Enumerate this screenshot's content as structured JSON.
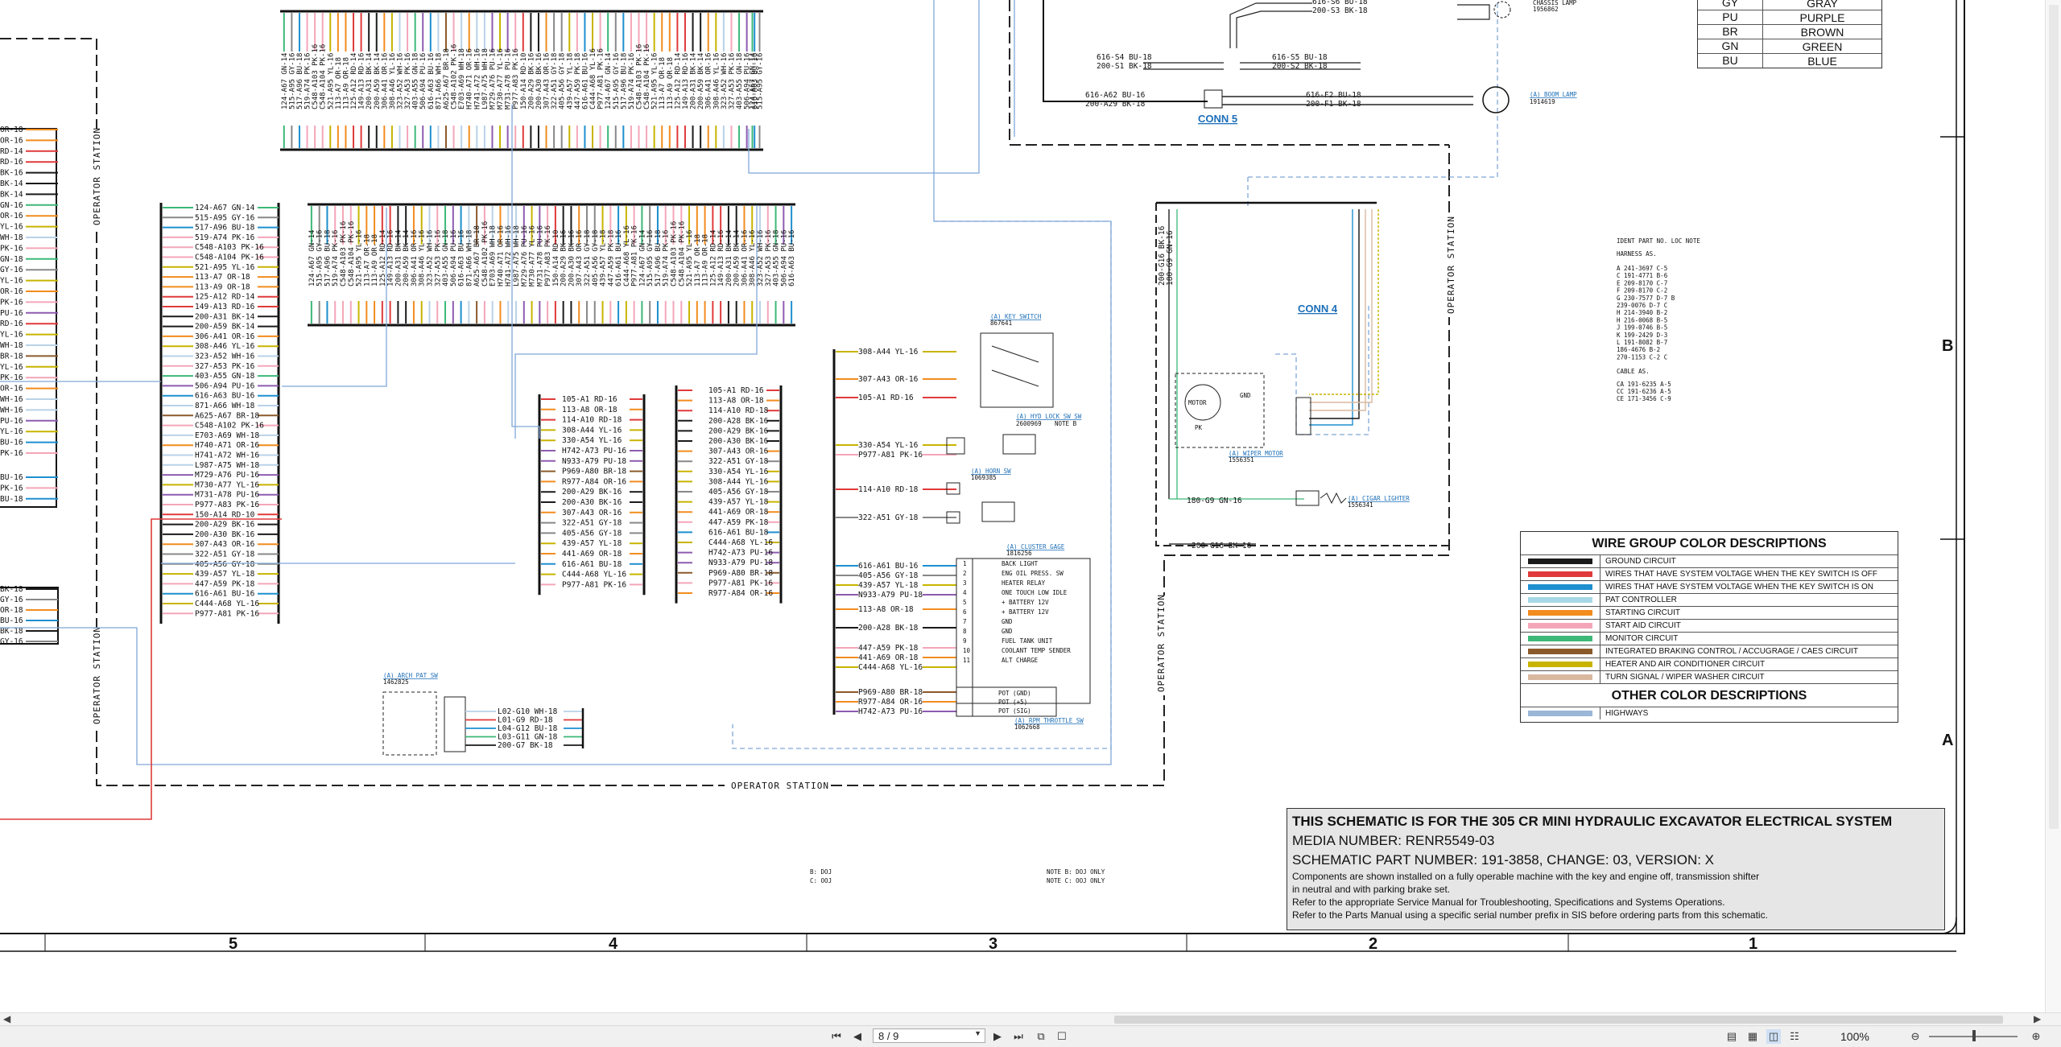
{
  "zones": {
    "col5": "5",
    "col4": "4",
    "col3": "3",
    "col2": "2",
    "col1": "1",
    "rowB": "B",
    "rowA": "A"
  },
  "stations": {
    "operator_station": "OPERATOR STATION"
  },
  "connectors": {
    "conn5": "CONN 5",
    "conn4": "CONN 4"
  },
  "colortable": [
    {
      "code": "GY",
      "name": "GRAY"
    },
    {
      "code": "PU",
      "name": "PURPLE"
    },
    {
      "code": "BR",
      "name": "BROWN"
    },
    {
      "code": "GN",
      "name": "GREEN"
    },
    {
      "code": "BU",
      "name": "BLUE"
    }
  ],
  "legend": {
    "title": "WIRE GROUP COLOR DESCRIPTIONS",
    "rows": [
      {
        "color": "#1a1a1a",
        "text": "GROUND CIRCUIT"
      },
      {
        "color": "#e03a3a",
        "text": "WIRES THAT HAVE SYSTEM VOLTAGE WHEN THE KEY SWITCH IS OFF"
      },
      {
        "color": "#1e8fd0",
        "text": "WIRES THAT HAVE SYSTEM VOLTAGE WHEN THE KEY SWITCH IS ON"
      },
      {
        "color": "#a6d8e6",
        "text": "PAT CONTROLLER"
      },
      {
        "color": "#f28c1e",
        "text": "STARTING CIRCUIT"
      },
      {
        "color": "#f4a6b8",
        "text": "START AID CIRCUIT"
      },
      {
        "color": "#3cb878",
        "text": "MONITOR CIRCUIT"
      },
      {
        "color": "#8b5a2b",
        "text": "INTEGRATED BRAKING CONTROL / ACCUGRAGE / CAES CIRCUIT"
      },
      {
        "color": "#c8b400",
        "text": "HEATER AND AIR CONDITIONER CIRCUIT"
      },
      {
        "color": "#d9b8a0",
        "text": "TURN SIGNAL / WIPER WASHER CIRCUIT"
      }
    ],
    "other_title": "OTHER COLOR DESCRIPTIONS",
    "other_rows": [
      {
        "color": "#9bb6d6",
        "text": "HIGHWAYS"
      }
    ]
  },
  "titleblock": {
    "line1": "THIS SCHEMATIC IS FOR THE 305 CR MINI HYDRAULIC EXCAVATOR ELECTRICAL SYSTEM",
    "line2": "MEDIA NUMBER: RENR5549-03",
    "line3": "SCHEMATIC PART NUMBER: 191-3858, CHANGE: 03, VERSION: X",
    "line4": "Components are shown installed on a fully operable machine with the key and engine off, transmission shifter",
    "line5": "in neutral and with parking brake set.",
    "line6": "Refer to the appropriate Service Manual for Troubleshooting, Specifications and Systems Operations.",
    "line7": "Refer to the Parts Manual using a specific serial number prefix in SIS before ordering parts from this schematic."
  },
  "wires": {
    "left_block": [
      "124-A67 GN-14",
      "515-A95 GY-16",
      "517-A96 BU-18",
      "519-A74 PK-16",
      "C548-A103 PK-16",
      "C548-A104 PK-16",
      "521-A95 YL-16",
      "113-A7 OR-18",
      "113-A9 OR-18",
      "125-A12 RD-14",
      "149-A13 RD-16",
      "200-A31 BK-14",
      "200-A59 BK-14",
      "306-A41 OR-16",
      "308-A46 YL-16",
      "323-A52 WH-16",
      "327-A53 PK-16",
      "403-A55 GN-18",
      "506-A94 PU-16",
      "616-A63 BU-16",
      "871-A66 WH-18",
      "A625-A67 BR-18",
      "C548-A102 PK-16",
      "E703-A69 WH-18",
      "H740-A71 OR-16",
      "H741-A72 WH-16",
      "L987-A75 WH-18",
      "M729-A76 PU-16",
      "M730-A77 YL-16",
      "M731-A78 PU-16",
      "P977-A83 PK-16",
      "150-A14 RD-10",
      "200-A29 BK-16",
      "200-A30 BK-16",
      "307-A43 OR-16",
      "322-A51 GY-18",
      "405-A56 GY-18",
      "439-A57 YL-18",
      "447-A59 PK-18",
      "616-A61 BU-16",
      "C444-A68 YL-16",
      "P977-A81 PK-16"
    ],
    "mid_block_a": [
      "105-A1 RD-16",
      "113-A8 OR-18",
      "114-A10 RD-18",
      "308-A44 YL-16",
      "330-A54 YL-16",
      "H742-A73 PU-16",
      "N933-A79 PU-18",
      "P969-A80 BR-18",
      "R977-A84 OR-16",
      "200-A29 BK-16",
      "200-A30 BK-16",
      "307-A43 OR-16",
      "322-A51 GY-18",
      "405-A56 GY-18",
      "439-A57 YL-18",
      "441-A69 OR-18",
      "616-A61 BU-18",
      "C444-A68 YL-16",
      "P977-A81 PK-16"
    ],
    "mid_block_b": [
      "105-A1 RD-16",
      "113-A8 OR-18",
      "114-A10 RD-18",
      "200-A28 BK-16",
      "200-A29 BK-16",
      "200-A30 BK-16",
      "307-A43 OR-16",
      "322-A51 GY-18",
      "330-A54 YL-16",
      "308-A44 YL-16",
      "405-A56 GY-18",
      "439-A57 YL-18",
      "441-A69 OR-18",
      "447-A59 PK-18",
      "616-A61 BU-18",
      "C444-A68 YL-16",
      "H742-A73 PU-16",
      "N933-A79 PU-18",
      "P969-A80 BR-18",
      "P977-A81 PK-16",
      "R977-A84 OR-16"
    ],
    "right_block": [
      "308-A44 YL-16",
      "307-A43 OR-16",
      "105-A1 RD-16",
      "330-A54 YL-16",
      "P977-A81 PK-16",
      "114-A10 RD-18",
      "322-A51 GY-18",
      "616-A61 BU-16",
      "405-A56 GY-18",
      "439-A57 YL-18",
      "N933-A79 PU-18",
      "113-A8 OR-18",
      "200-A28 BK-18",
      "447-A59 PK-18",
      "441-A69 OR-18",
      "C444-A68 YL-16",
      "P969-A80 BR-18",
      "R977-A84 OR-16",
      "H742-A73 PU-16"
    ],
    "edge_left": [
      "OR-18",
      "OR-16",
      "RD-14",
      "RD-16",
      "BK-16",
      "BK-14",
      "BK-14",
      "GN-16",
      "OR-16",
      "YL-16",
      "WH-18",
      "PK-16",
      "GN-18",
      "GY-16",
      "YL-16",
      "OR-16",
      "PK-16",
      "PU-16",
      "RD-16",
      "YL-16",
      "WH-18",
      "BR-18",
      "YL-16",
      "PK-16",
      "OR-16",
      "WH-16",
      "WH-16",
      "PU-16",
      "YL-16",
      "BU-16",
      "PK-16",
      "BU-16",
      "PK-16",
      "BU-18",
      "BK-18",
      "GY-16",
      "OR-18",
      "BU-16",
      "BK-18",
      "GY-16",
      "OR-16",
      "BU-16"
    ],
    "cluster_pins": [
      "BACK LIGHT",
      "ENG OIL PRESS. SW",
      "HEATER RELAY",
      "ONE TOUCH LOW IDLE",
      "+ BATTERY 12V",
      "+ BATTERY 12V",
      "GND",
      "GND",
      "FUEL TANK UNIT",
      "COOLANT TEMP SENDER",
      "ALT CHARGE"
    ],
    "pot_pins": [
      "POT (GND)",
      "POT (+5)",
      "POT (SIG)"
    ],
    "top_right": [
      "616-S6 BU-18",
      "200-S3 BK-18",
      "616-S4 BU-18",
      "200-S1 BK-18",
      "616-S5 BU-18",
      "200-S2 BK-18",
      "616-A62 BU-16",
      "200-A29 BK-18",
      "616-F2 BU-18",
      "200-F1 BK-18"
    ],
    "conn4": [
      "200-G16 BK-16",
      "180-G9 GN-16",
      "200-G16 BK-16",
      "180-G9 GN-16"
    ],
    "lower_small": [
      "L02-G10 WH-18",
      "L01-G9 RD-18",
      "L04-G12 BU-18",
      "L03-G11 GN-18",
      "200-G7 BK-18"
    ]
  },
  "components": {
    "key_switch": "(A) KEY SWITCH",
    "key_switch_pn": "867641",
    "hyd_lock": "(A) HYD LOCK SW SW",
    "hyd_lock_pn": "2600969",
    "note_b": "NOTE B",
    "horn_sw": "(A) HORN SW",
    "horn_pn": "1069385",
    "cluster": "(A) CLUSTER GAGE",
    "cluster_pn": "1816256",
    "rpm_throttle": "(A) RPM THROTTLE SW",
    "rpm_pn": "1062668",
    "arch_pat": "(A) ARCH PAT SW",
    "arch_pn": "1462825",
    "wiper_motor": "(A) WIPER MOTOR",
    "wiper_pn": "1556351",
    "cigar_lighter": "(A) CIGAR LIGHTER",
    "cigar_pn": "1556341",
    "boom_lamp": "(A) BOOM LAMP",
    "boom_pn": "1914619",
    "chassis_lamp": "CHASSIS LAMP",
    "chassis_pn": "1956862",
    "motor": "MOTOR",
    "gnd": "GND",
    "pk": "PK",
    "ident_header": "IDENT   PART NO.   LOC   NOTE",
    "harness_label": "HARNESS AS.",
    "cable_label": "CABLE AS.",
    "ident_rows": [
      "A     241-3697   C-5",
      "C     191-4771   B-6",
      "E     209-8170   C-7",
      "F     209-8170   C-2",
      "G     230-7577   D-7   B",
      "      239-0076   D-7   C",
      "H     214-3940   B-2",
      "H     216-0068   B-5",
      "J     199-0746   B-5",
      "K     199-2429   D-3",
      "L     191-8082   B-7",
      "      186-4676   B-2",
      "      270-1153   C-2   C"
    ],
    "cable_rows": [
      "CA    191-6235   A-5",
      "CC    191-6236   A-5",
      "CE    171-3456   C-9"
    ],
    "notes_left": [
      "B: DOJ",
      "C: OOJ"
    ],
    "notes_right": [
      "NOTE B: DOJ ONLY",
      "NOTE C: OOJ ONLY"
    ]
  },
  "toolbar": {
    "page_value": "8 / 9",
    "zoom": "100%",
    "first_page": "first-page",
    "prev_page": "prev-page",
    "next_page": "next-page",
    "last_page": "last-page"
  }
}
